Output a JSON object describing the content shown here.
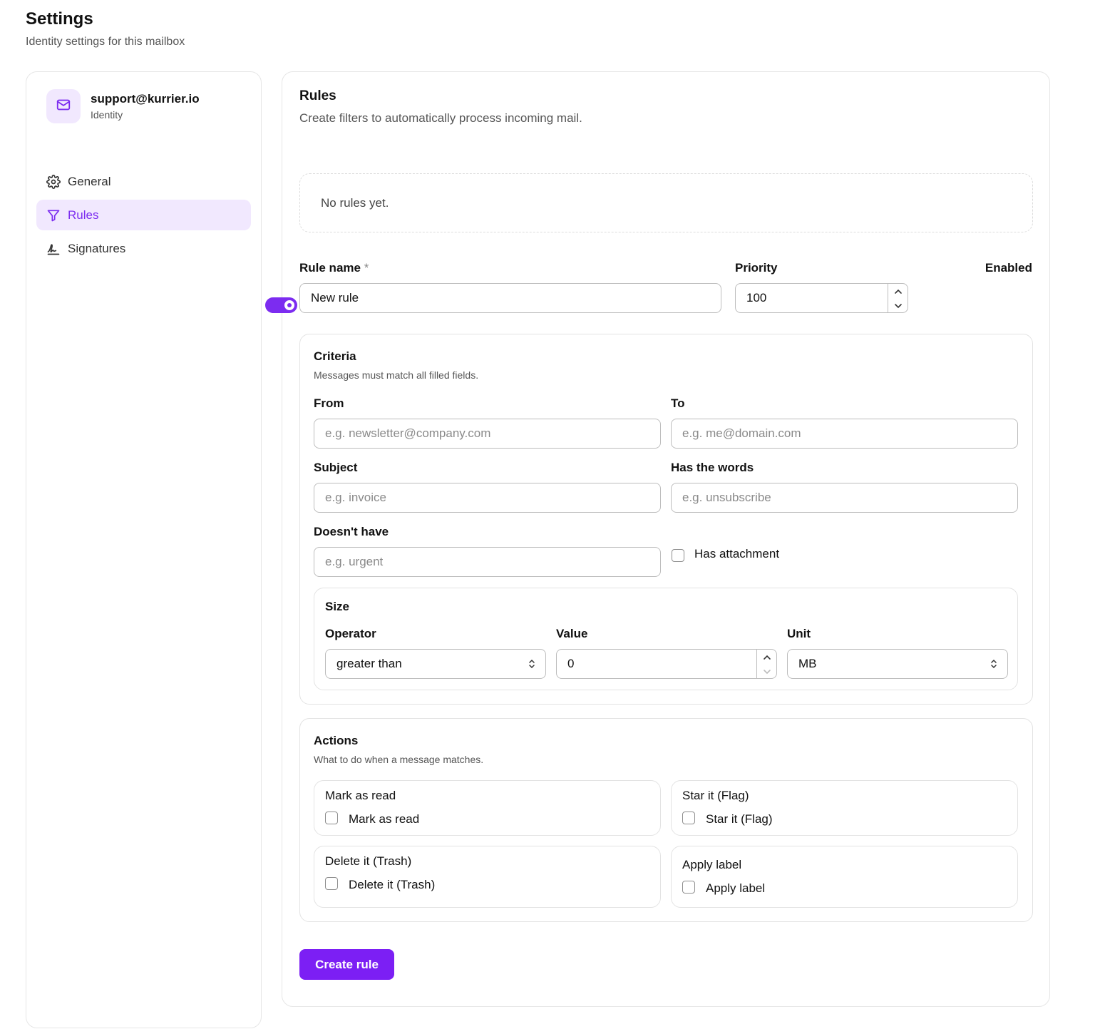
{
  "header": {
    "title": "Settings",
    "subtitle": "Identity settings for this mailbox"
  },
  "sidebar": {
    "identity": {
      "email": "support@kurrier.io",
      "label": "Identity",
      "icon": "mail-icon"
    },
    "items": [
      {
        "label": "General",
        "icon": "gear-icon",
        "active": false
      },
      {
        "label": "Rules",
        "icon": "filter-icon",
        "active": true
      },
      {
        "label": "Signatures",
        "icon": "signature-icon",
        "active": false
      }
    ]
  },
  "rules": {
    "title": "Rules",
    "description": "Create filters to automatically process incoming mail.",
    "empty_text": "No rules yet."
  },
  "form": {
    "rule_name_label": "Rule name",
    "required_marker": "*",
    "rule_name_value": "New rule",
    "priority_label": "Priority",
    "priority_value": "100",
    "enabled_label": "Enabled",
    "enabled": true
  },
  "criteria": {
    "title": "Criteria",
    "description": "Messages must match all filled fields.",
    "from_label": "From",
    "from_placeholder": "e.g. newsletter@company.com",
    "to_label": "To",
    "to_placeholder": "e.g. me@domain.com",
    "subject_label": "Subject",
    "subject_placeholder": "e.g. invoice",
    "has_words_label": "Has the words",
    "has_words_placeholder": "e.g. unsubscribe",
    "doesnt_have_label": "Doesn't have",
    "doesnt_have_placeholder": "e.g. urgent",
    "has_attachment_label": "Has attachment",
    "size": {
      "title": "Size",
      "operator_label": "Operator",
      "operator_value": "greater than",
      "value_label": "Value",
      "value_value": "0",
      "unit_label": "Unit",
      "unit_value": "MB"
    }
  },
  "actions": {
    "title": "Actions",
    "description": "What to do when a message matches.",
    "items": [
      {
        "title": "Mark as read",
        "checkbox_label": "Mark as read"
      },
      {
        "title": "Star it (Flag)",
        "checkbox_label": "Star it (Flag)"
      },
      {
        "title": "Delete it (Trash)",
        "checkbox_label": "Delete it (Trash)"
      },
      {
        "title": "Apply label",
        "checkbox_label": "Apply label"
      }
    ]
  },
  "create_button_label": "Create rule",
  "colors": {
    "accent": "#7c2cf0",
    "accent_light": "#f1e8fe",
    "border": "#e6e6e6"
  }
}
